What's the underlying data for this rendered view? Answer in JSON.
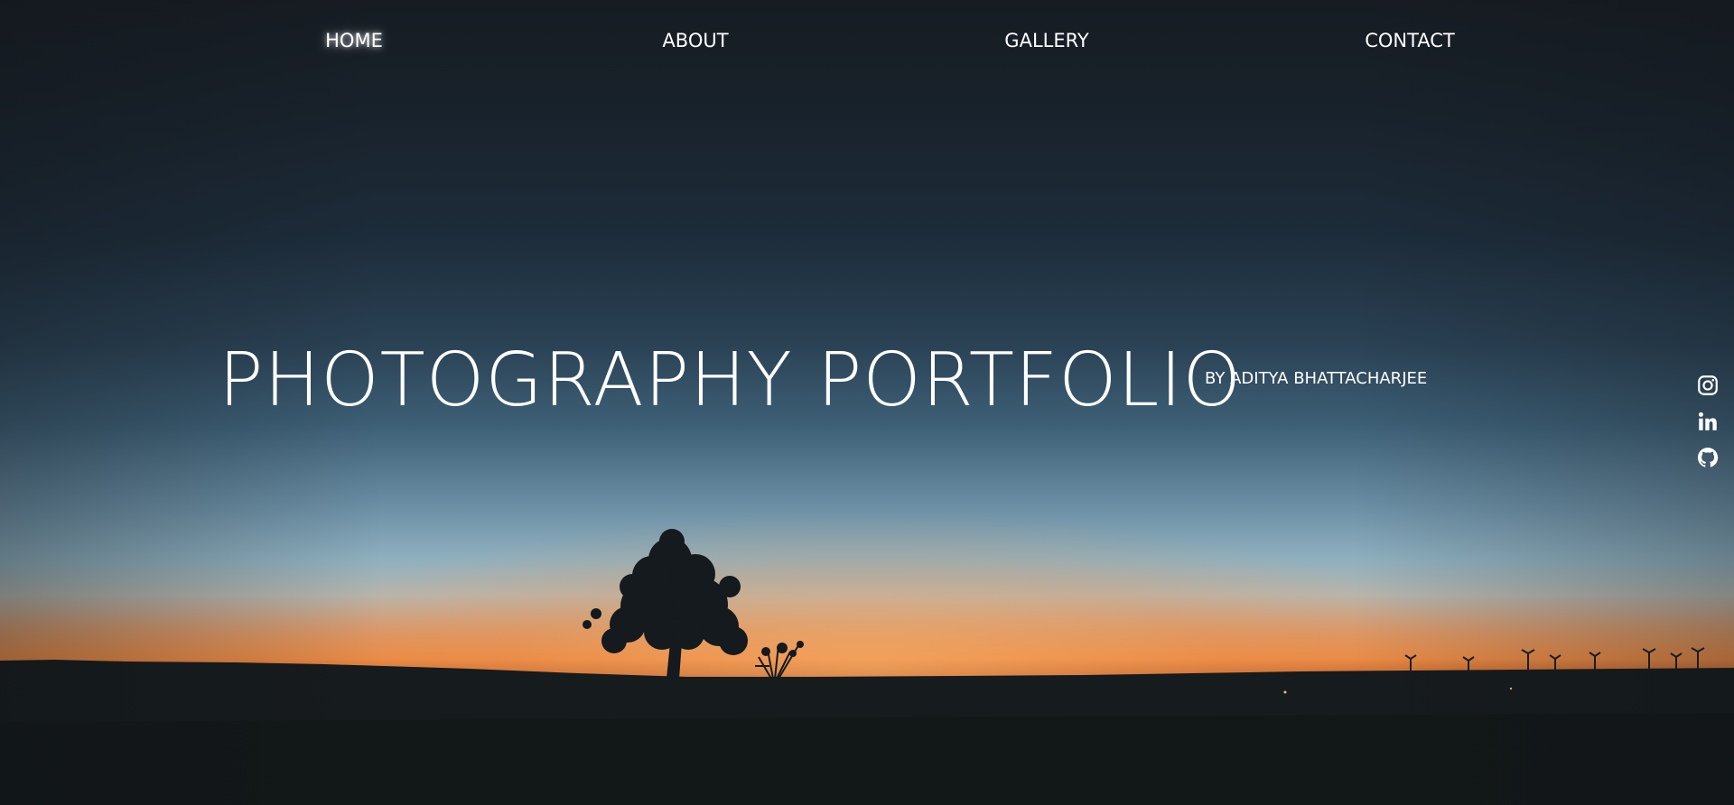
{
  "nav": {
    "items": [
      {
        "label": "HOME",
        "active": true
      },
      {
        "label": "ABOUT",
        "active": false
      },
      {
        "label": "GALLERY",
        "active": false
      },
      {
        "label": "CONTACT",
        "active": false
      }
    ]
  },
  "hero": {
    "title": "PHOTOGRAPHY PORTFOLIO",
    "byline": "BY ADITYA BHATTACHARJEE",
    "background": "sunset-tree-silhouette-photo"
  },
  "social": {
    "icons": [
      "instagram-icon",
      "linkedin-icon",
      "github-icon"
    ]
  },
  "colors": {
    "text": "#ffffff",
    "sky_top": "#161c22",
    "sky_mid": "#3d5f76",
    "horizon_glow": "#ea8a45",
    "ground": "#131719"
  }
}
